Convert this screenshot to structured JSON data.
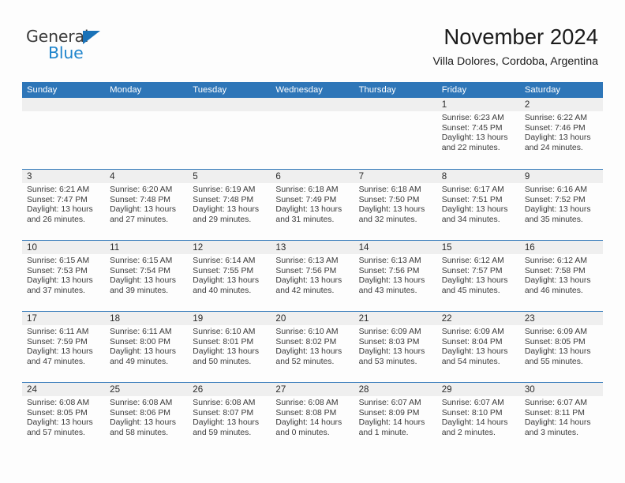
{
  "brand": {
    "name_part1": "General",
    "name_part2": "Blue",
    "accent_color": "#1e84cc",
    "triangle_color": "#1a72b8"
  },
  "header": {
    "title": "November 2024",
    "subtitle": "Villa Dolores, Cordoba, Argentina"
  },
  "calendar": {
    "header_bg": "#2e76b8",
    "date_band_bg": "#efefef",
    "weekdays": [
      "Sunday",
      "Monday",
      "Tuesday",
      "Wednesday",
      "Thursday",
      "Friday",
      "Saturday"
    ],
    "weeks": [
      [
        {
          "date": "",
          "empty": true
        },
        {
          "date": "",
          "empty": true
        },
        {
          "date": "",
          "empty": true
        },
        {
          "date": "",
          "empty": true
        },
        {
          "date": "",
          "empty": true
        },
        {
          "date": "1",
          "sunrise": "Sunrise: 6:23 AM",
          "sunset": "Sunset: 7:45 PM",
          "daylight_line1": "Daylight: 13 hours",
          "daylight_line2": "and 22 minutes."
        },
        {
          "date": "2",
          "sunrise": "Sunrise: 6:22 AM",
          "sunset": "Sunset: 7:46 PM",
          "daylight_line1": "Daylight: 13 hours",
          "daylight_line2": "and 24 minutes."
        }
      ],
      [
        {
          "date": "3",
          "sunrise": "Sunrise: 6:21 AM",
          "sunset": "Sunset: 7:47 PM",
          "daylight_line1": "Daylight: 13 hours",
          "daylight_line2": "and 26 minutes."
        },
        {
          "date": "4",
          "sunrise": "Sunrise: 6:20 AM",
          "sunset": "Sunset: 7:48 PM",
          "daylight_line1": "Daylight: 13 hours",
          "daylight_line2": "and 27 minutes."
        },
        {
          "date": "5",
          "sunrise": "Sunrise: 6:19 AM",
          "sunset": "Sunset: 7:48 PM",
          "daylight_line1": "Daylight: 13 hours",
          "daylight_line2": "and 29 minutes."
        },
        {
          "date": "6",
          "sunrise": "Sunrise: 6:18 AM",
          "sunset": "Sunset: 7:49 PM",
          "daylight_line1": "Daylight: 13 hours",
          "daylight_line2": "and 31 minutes."
        },
        {
          "date": "7",
          "sunrise": "Sunrise: 6:18 AM",
          "sunset": "Sunset: 7:50 PM",
          "daylight_line1": "Daylight: 13 hours",
          "daylight_line2": "and 32 minutes."
        },
        {
          "date": "8",
          "sunrise": "Sunrise: 6:17 AM",
          "sunset": "Sunset: 7:51 PM",
          "daylight_line1": "Daylight: 13 hours",
          "daylight_line2": "and 34 minutes."
        },
        {
          "date": "9",
          "sunrise": "Sunrise: 6:16 AM",
          "sunset": "Sunset: 7:52 PM",
          "daylight_line1": "Daylight: 13 hours",
          "daylight_line2": "and 35 minutes."
        }
      ],
      [
        {
          "date": "10",
          "sunrise": "Sunrise: 6:15 AM",
          "sunset": "Sunset: 7:53 PM",
          "daylight_line1": "Daylight: 13 hours",
          "daylight_line2": "and 37 minutes."
        },
        {
          "date": "11",
          "sunrise": "Sunrise: 6:15 AM",
          "sunset": "Sunset: 7:54 PM",
          "daylight_line1": "Daylight: 13 hours",
          "daylight_line2": "and 39 minutes."
        },
        {
          "date": "12",
          "sunrise": "Sunrise: 6:14 AM",
          "sunset": "Sunset: 7:55 PM",
          "daylight_line1": "Daylight: 13 hours",
          "daylight_line2": "and 40 minutes."
        },
        {
          "date": "13",
          "sunrise": "Sunrise: 6:13 AM",
          "sunset": "Sunset: 7:56 PM",
          "daylight_line1": "Daylight: 13 hours",
          "daylight_line2": "and 42 minutes."
        },
        {
          "date": "14",
          "sunrise": "Sunrise: 6:13 AM",
          "sunset": "Sunset: 7:56 PM",
          "daylight_line1": "Daylight: 13 hours",
          "daylight_line2": "and 43 minutes."
        },
        {
          "date": "15",
          "sunrise": "Sunrise: 6:12 AM",
          "sunset": "Sunset: 7:57 PM",
          "daylight_line1": "Daylight: 13 hours",
          "daylight_line2": "and 45 minutes."
        },
        {
          "date": "16",
          "sunrise": "Sunrise: 6:12 AM",
          "sunset": "Sunset: 7:58 PM",
          "daylight_line1": "Daylight: 13 hours",
          "daylight_line2": "and 46 minutes."
        }
      ],
      [
        {
          "date": "17",
          "sunrise": "Sunrise: 6:11 AM",
          "sunset": "Sunset: 7:59 PM",
          "daylight_line1": "Daylight: 13 hours",
          "daylight_line2": "and 47 minutes."
        },
        {
          "date": "18",
          "sunrise": "Sunrise: 6:11 AM",
          "sunset": "Sunset: 8:00 PM",
          "daylight_line1": "Daylight: 13 hours",
          "daylight_line2": "and 49 minutes."
        },
        {
          "date": "19",
          "sunrise": "Sunrise: 6:10 AM",
          "sunset": "Sunset: 8:01 PM",
          "daylight_line1": "Daylight: 13 hours",
          "daylight_line2": "and 50 minutes."
        },
        {
          "date": "20",
          "sunrise": "Sunrise: 6:10 AM",
          "sunset": "Sunset: 8:02 PM",
          "daylight_line1": "Daylight: 13 hours",
          "daylight_line2": "and 52 minutes."
        },
        {
          "date": "21",
          "sunrise": "Sunrise: 6:09 AM",
          "sunset": "Sunset: 8:03 PM",
          "daylight_line1": "Daylight: 13 hours",
          "daylight_line2": "and 53 minutes."
        },
        {
          "date": "22",
          "sunrise": "Sunrise: 6:09 AM",
          "sunset": "Sunset: 8:04 PM",
          "daylight_line1": "Daylight: 13 hours",
          "daylight_line2": "and 54 minutes."
        },
        {
          "date": "23",
          "sunrise": "Sunrise: 6:09 AM",
          "sunset": "Sunset: 8:05 PM",
          "daylight_line1": "Daylight: 13 hours",
          "daylight_line2": "and 55 minutes."
        }
      ],
      [
        {
          "date": "24",
          "sunrise": "Sunrise: 6:08 AM",
          "sunset": "Sunset: 8:05 PM",
          "daylight_line1": "Daylight: 13 hours",
          "daylight_line2": "and 57 minutes."
        },
        {
          "date": "25",
          "sunrise": "Sunrise: 6:08 AM",
          "sunset": "Sunset: 8:06 PM",
          "daylight_line1": "Daylight: 13 hours",
          "daylight_line2": "and 58 minutes."
        },
        {
          "date": "26",
          "sunrise": "Sunrise: 6:08 AM",
          "sunset": "Sunset: 8:07 PM",
          "daylight_line1": "Daylight: 13 hours",
          "daylight_line2": "and 59 minutes."
        },
        {
          "date": "27",
          "sunrise": "Sunrise: 6:08 AM",
          "sunset": "Sunset: 8:08 PM",
          "daylight_line1": "Daylight: 14 hours",
          "daylight_line2": "and 0 minutes."
        },
        {
          "date": "28",
          "sunrise": "Sunrise: 6:07 AM",
          "sunset": "Sunset: 8:09 PM",
          "daylight_line1": "Daylight: 14 hours",
          "daylight_line2": "and 1 minute."
        },
        {
          "date": "29",
          "sunrise": "Sunrise: 6:07 AM",
          "sunset": "Sunset: 8:10 PM",
          "daylight_line1": "Daylight: 14 hours",
          "daylight_line2": "and 2 minutes."
        },
        {
          "date": "30",
          "sunrise": "Sunrise: 6:07 AM",
          "sunset": "Sunset: 8:11 PM",
          "daylight_line1": "Daylight: 14 hours",
          "daylight_line2": "and 3 minutes."
        }
      ]
    ]
  }
}
